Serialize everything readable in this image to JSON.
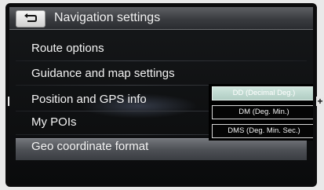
{
  "header": {
    "title": "Navigation settings",
    "back_icon": "back-arrow-icon"
  },
  "menu": {
    "items": [
      {
        "label": "Route options"
      },
      {
        "label": "Guidance and map settings"
      },
      {
        "label": "Position and GPS info"
      },
      {
        "label": "My POIs"
      },
      {
        "label": "Geo coordinate format"
      }
    ],
    "selected": "Geo coordinate format"
  },
  "popup": {
    "options": [
      {
        "label": "DD (Decimal Deg.)",
        "selected": true
      },
      {
        "label": "DM (Deg. Min.)",
        "selected": false
      },
      {
        "label": "DMS (Deg. Min. Sec.)",
        "selected": false
      }
    ]
  },
  "side_indicators": {
    "left": "+",
    "right": "+"
  },
  "colors": {
    "highlight": "#4e5156",
    "selected_option": "#b0cdc3",
    "text": "#f3f3f3"
  }
}
